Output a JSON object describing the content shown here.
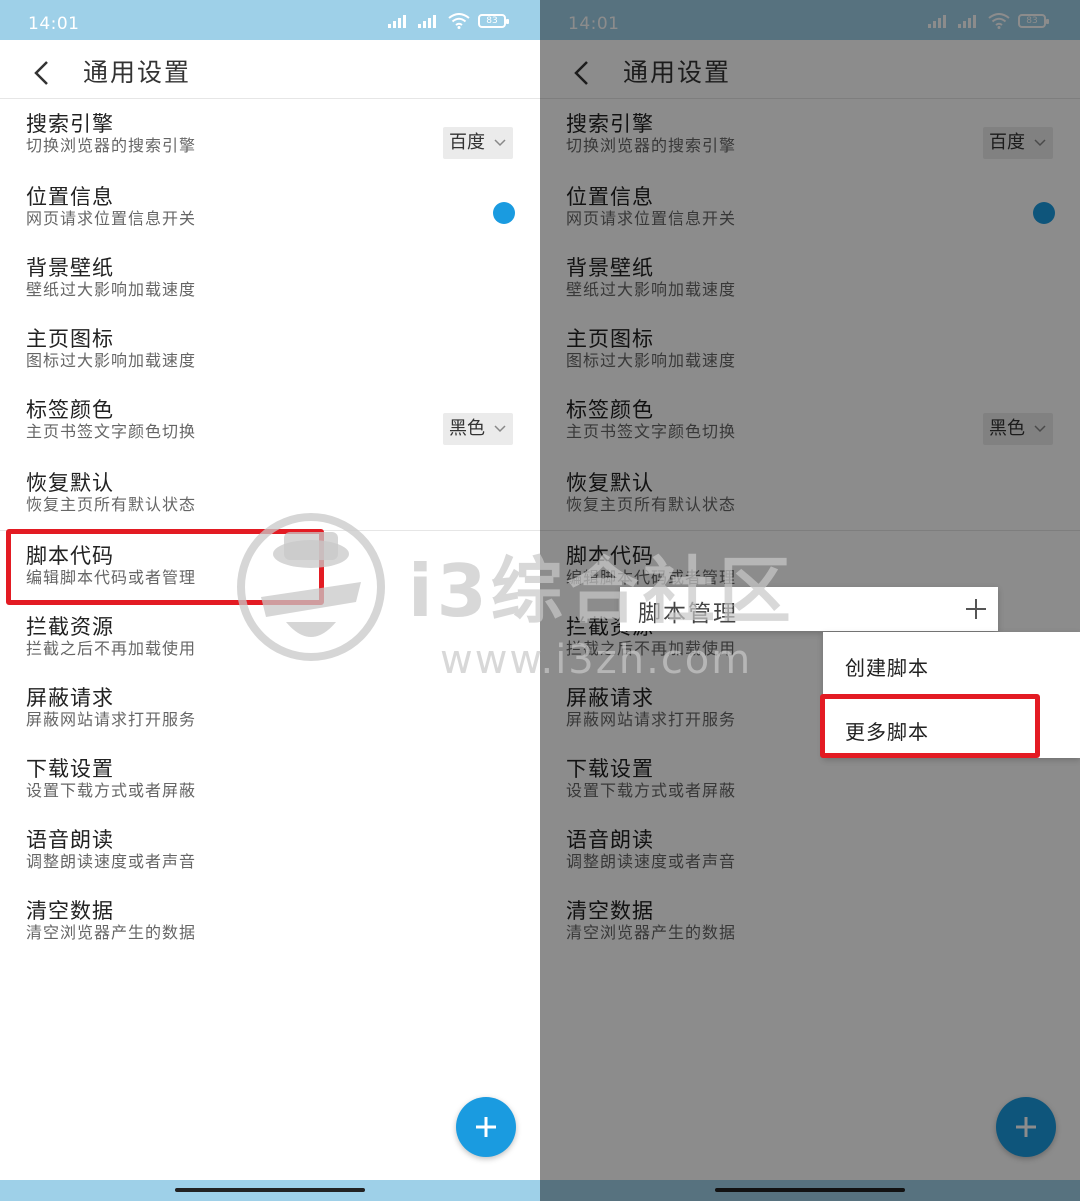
{
  "colors": {
    "accent": "#1a9be0",
    "statusbar": "#9ed0e8",
    "highlight": "#e31b23"
  },
  "left": {
    "status": {
      "time": "14:01",
      "battery": "83"
    },
    "title": "通用设置",
    "settings": [
      {
        "title": "搜索引擎",
        "subtitle": "切换浏览器的搜索引擎",
        "control": "select",
        "value": "百度"
      },
      {
        "title": "位置信息",
        "subtitle": "网页请求位置信息开关",
        "control": "toggle"
      },
      {
        "title": "背景壁纸",
        "subtitle": "壁纸过大影响加载速度"
      },
      {
        "title": "主页图标",
        "subtitle": "图标过大影响加载速度"
      },
      {
        "title": "标签颜色",
        "subtitle": "主页书签文字颜色切换",
        "control": "select",
        "value": "黑色"
      },
      {
        "title": "恢复默认",
        "subtitle": "恢复主页所有默认状态"
      },
      {
        "title": "脚本代码",
        "subtitle": "编辑脚本代码或者管理"
      },
      {
        "title": "拦截资源",
        "subtitle": "拦截之后不再加载使用"
      },
      {
        "title": "屏蔽请求",
        "subtitle": "屏蔽网站请求打开服务"
      },
      {
        "title": "下载设置",
        "subtitle": "设置下载方式或者屏蔽"
      },
      {
        "title": "语音朗读",
        "subtitle": "调整朗读速度或者声音"
      },
      {
        "title": "清空数据",
        "subtitle": "清空浏览器产生的数据"
      }
    ]
  },
  "right": {
    "status": {
      "time": "14:01",
      "battery": "83"
    },
    "title": "通用设置",
    "settings": [
      {
        "title": "搜索引擎",
        "subtitle": "切换浏览器的搜索引擎",
        "control": "select",
        "value": "百度"
      },
      {
        "title": "位置信息",
        "subtitle": "网页请求位置信息开关",
        "control": "toggle"
      },
      {
        "title": "背景壁纸",
        "subtitle": "壁纸过大影响加载速度"
      },
      {
        "title": "主页图标",
        "subtitle": "图标过大影响加载速度"
      },
      {
        "title": "标签颜色",
        "subtitle": "主页书签文字颜色切换",
        "control": "select",
        "value": "黑色"
      },
      {
        "title": "恢复默认",
        "subtitle": "恢复主页所有默认状态"
      },
      {
        "title": "脚本代码",
        "subtitle": "编辑脚本代码或者管理"
      },
      {
        "title": "拦截资源",
        "subtitle": "拦截之后不再加载使用"
      },
      {
        "title": "屏蔽请求",
        "subtitle": "屏蔽网站请求打开服务"
      },
      {
        "title": "下载设置",
        "subtitle": "设置下载方式或者屏蔽"
      },
      {
        "title": "语音朗读",
        "subtitle": "调整朗读速度或者声音"
      },
      {
        "title": "清空数据",
        "subtitle": "清空浏览器产生的数据"
      }
    ],
    "popup": {
      "title": "脚本管理",
      "menu": [
        "创建脚本",
        "更多脚本"
      ]
    }
  },
  "watermark": {
    "text": "i3综合社区",
    "url": "www.i3zh.com"
  }
}
